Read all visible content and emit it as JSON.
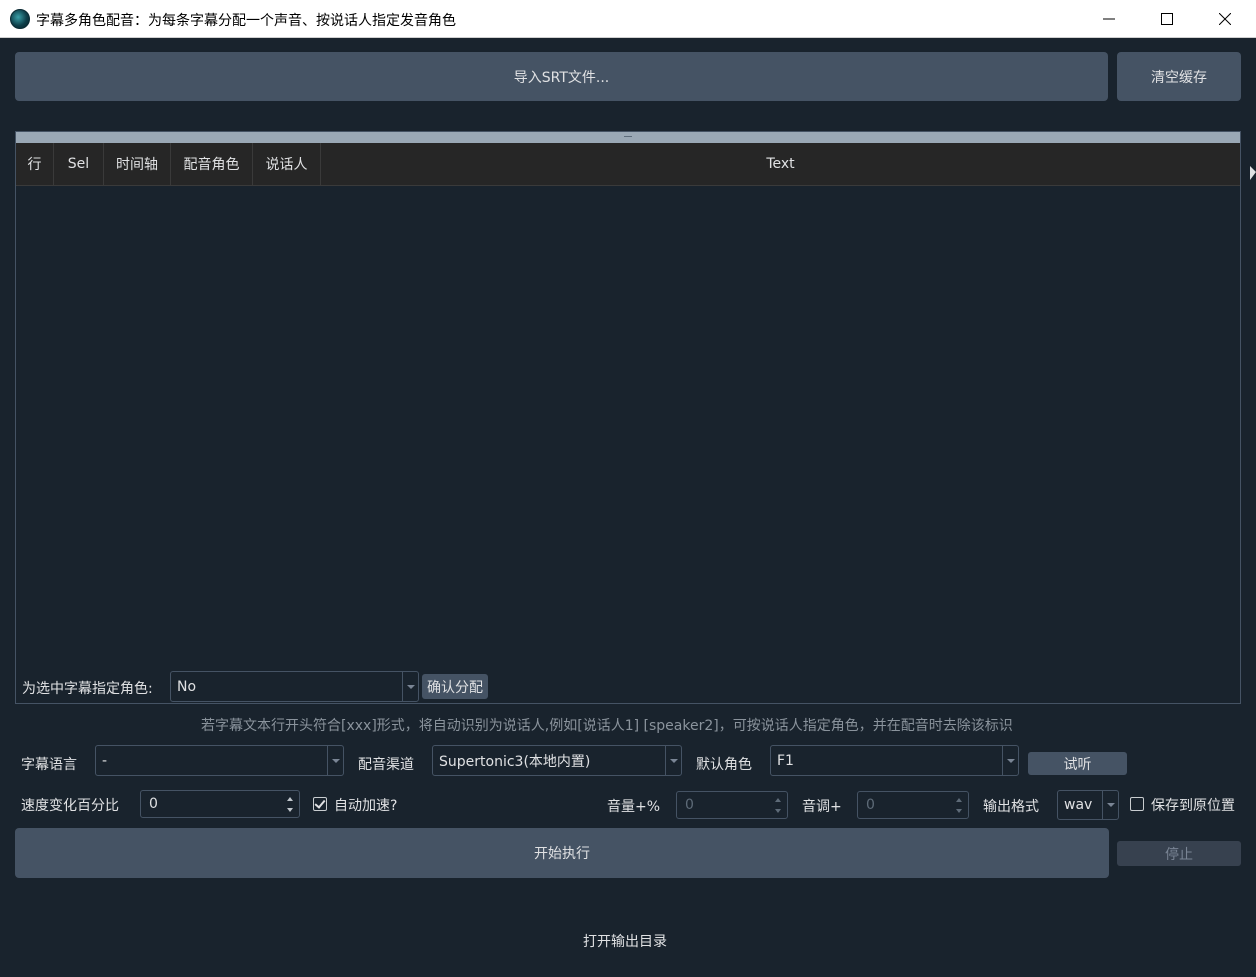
{
  "window": {
    "title": "字幕多角色配音：为每条字幕分配一个声音、按说话人指定发音角色",
    "icon": "app-logo-icon",
    "controls": [
      "minimize-icon",
      "maximize-icon",
      "close-icon"
    ]
  },
  "top_buttons": {
    "import_label": "导入SRT文件...",
    "clear_cache_label": "清空缓存"
  },
  "table": {
    "columns": [
      "行",
      "Sel",
      "时间轴",
      "配音角色",
      "说话人",
      "Text"
    ],
    "rows": []
  },
  "assign": {
    "label": "为选中字幕指定角色:",
    "selected": "No",
    "confirm_label": "确认分配"
  },
  "hint_text": "若字幕文本行开头符合[xxx]形式，将自动识别为说话人,例如[说话人1] [speaker2]，可按说话人指定角色，并在配音时去除该标识",
  "settings": {
    "subtitle_lang_label": "字幕语言",
    "subtitle_lang_value": "-",
    "channel_label": "配音渠道",
    "channel_value": "Supertonic3(本地内置)",
    "default_role_label": "默认角色",
    "default_role_value": "F1",
    "preview_label": "试听",
    "speed_label": "速度变化百分比",
    "speed_value": "0",
    "auto_speed_label": "自动加速?",
    "auto_speed_checked": true,
    "volume_label": "音量+%",
    "volume_value": "0",
    "pitch_label": "音调+",
    "pitch_value": "0",
    "format_label": "输出格式",
    "format_value": "wav",
    "save_original_label": "保存到原位置",
    "save_original_checked": false
  },
  "actions": {
    "start_label": "开始执行",
    "stop_label": "停止",
    "open_output_label": "打开输出目录"
  },
  "colors": {
    "background": "#19232d",
    "button": "#455364",
    "table_header": "#262626",
    "text": "#e0e1e3"
  }
}
